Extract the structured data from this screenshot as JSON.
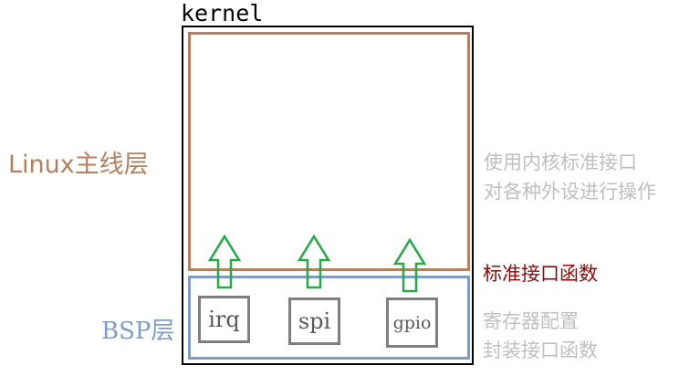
{
  "kernel": {
    "title": "kernel",
    "border_color": "#000000"
  },
  "linux_layer": {
    "label": "Linux主线层",
    "color": "#b5805f",
    "note_line1": "使用内核标准接口",
    "note_line2": "对各种外设进行操作"
  },
  "standard_interface": {
    "label": "标准接口函数",
    "color": "#8b0a0a"
  },
  "bsp_layer": {
    "label": "BSP层",
    "color": "#7f9cc6",
    "note_line1": "寄存器配置",
    "note_line2": "封装接口函数",
    "modules": [
      {
        "label": "irq"
      },
      {
        "label": "spi"
      },
      {
        "label": "gpio"
      }
    ]
  },
  "arrows": {
    "color": "#22aa44",
    "direction": "up"
  },
  "module_border_color": "#7f7f7f",
  "note_color": "#bfbfbf"
}
